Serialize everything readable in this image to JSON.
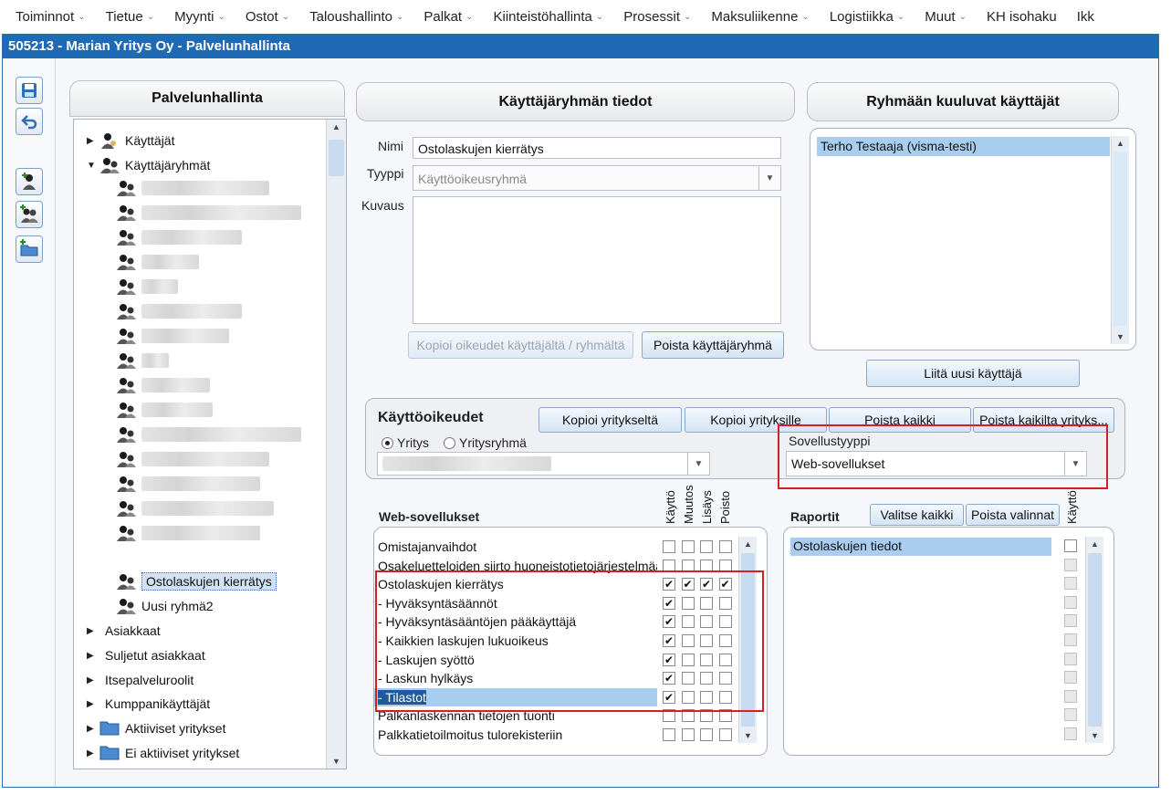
{
  "menu": [
    "Toiminnot",
    "Tietue",
    "Myynti",
    "Ostot",
    "Taloushallinto",
    "Palkat",
    "Kiinteistöhallinta",
    "Prosessit",
    "Maksuliikenne",
    "Logistiikka",
    "Muut",
    "KH isohaku",
    "Ikk"
  ],
  "window_title": "505213 - Marian Yritys Oy - Palvelunhallinta",
  "left_panel": {
    "title": "Palvelunhallinta",
    "users": "Käyttäjät",
    "groups": "Käyttäjäryhmät",
    "selected_group": "Ostolaskujen kierrätys",
    "new_group": "Uusi ryhmä2",
    "customers": "Asiakkaat",
    "closed_customers": "Suljetut asiakkaat",
    "self_service": "Itsepalveluroolit",
    "partners": "Kumppanikäyttäjät",
    "active_companies": "Aktiiviset yritykset",
    "inactive_companies": "Ei aktiiviset yritykset"
  },
  "group_info": {
    "title": "Käyttäjäryhmän tiedot",
    "name_label": "Nimi",
    "name_value": "Ostolaskujen kierrätys",
    "type_label": "Tyyppi",
    "type_value": "Käyttöoikeusryhmä",
    "desc_label": "Kuvaus",
    "copy_button": "Kopioi oikeudet käyttäjältä / ryhmältä",
    "delete_button": "Poista käyttäjäryhmä"
  },
  "members": {
    "title": "Ryhmään kuuluvat käyttäjät",
    "items": [
      "Terho Testaaja (visma-testi)"
    ],
    "add_button": "Liitä uusi käyttäjä"
  },
  "rights": {
    "title": "Käyttöoikeudet",
    "copy_from": "Kopioi yritykseltä",
    "copy_to": "Kopioi yrityksille",
    "delete_all": "Poista kaikki",
    "delete_all_companies": "Poista kaikilta yrityks...",
    "radio_company": "Yritys",
    "radio_group": "Yritysryhmä",
    "app_type_label": "Sovellustyyppi",
    "app_type_value": "Web-sovellukset"
  },
  "web_apps": {
    "title": "Web-sovellukset",
    "columns": [
      "Käyttö",
      "Muutos",
      "Lisäys",
      "Poisto"
    ],
    "rows": [
      {
        "label": "Omistajanvaihdot",
        "checks": [
          false,
          false,
          false,
          false
        ]
      },
      {
        "label": "Osakeluetteloiden siirto huoneistotietojärjestelmään",
        "checks": [
          false,
          false,
          false,
          false
        ]
      },
      {
        "label": "Ostolaskujen kierrätys",
        "checks": [
          true,
          true,
          true,
          true
        ]
      },
      {
        "label": "- Hyväksyntäsäännöt",
        "checks": [
          true,
          false,
          false,
          false
        ]
      },
      {
        "label": "- Hyväksyntäsääntöjen pääkäyttäjä",
        "checks": [
          true,
          false,
          false,
          false
        ]
      },
      {
        "label": "- Kaikkien laskujen lukuoikeus",
        "checks": [
          true,
          false,
          false,
          false
        ]
      },
      {
        "label": "- Laskujen syöttö",
        "checks": [
          true,
          false,
          false,
          false
        ]
      },
      {
        "label": "- Laskun hylkäys",
        "checks": [
          true,
          false,
          false,
          false
        ]
      },
      {
        "label": "- Tilastot",
        "checks": [
          true,
          false,
          false,
          false
        ]
      },
      {
        "label": "Palkanlaskennan tietojen tuonti",
        "checks": [
          false,
          false,
          false,
          false
        ]
      },
      {
        "label": "Palkkatietoilmoitus tulorekisteriin",
        "checks": [
          false,
          false,
          false,
          false
        ]
      }
    ]
  },
  "reports": {
    "title": "Raportit",
    "select_all": "Valitse kaikki",
    "clear": "Poista valinnat",
    "column": "Käyttö",
    "items": [
      "Ostolaskujen tiedot"
    ]
  }
}
